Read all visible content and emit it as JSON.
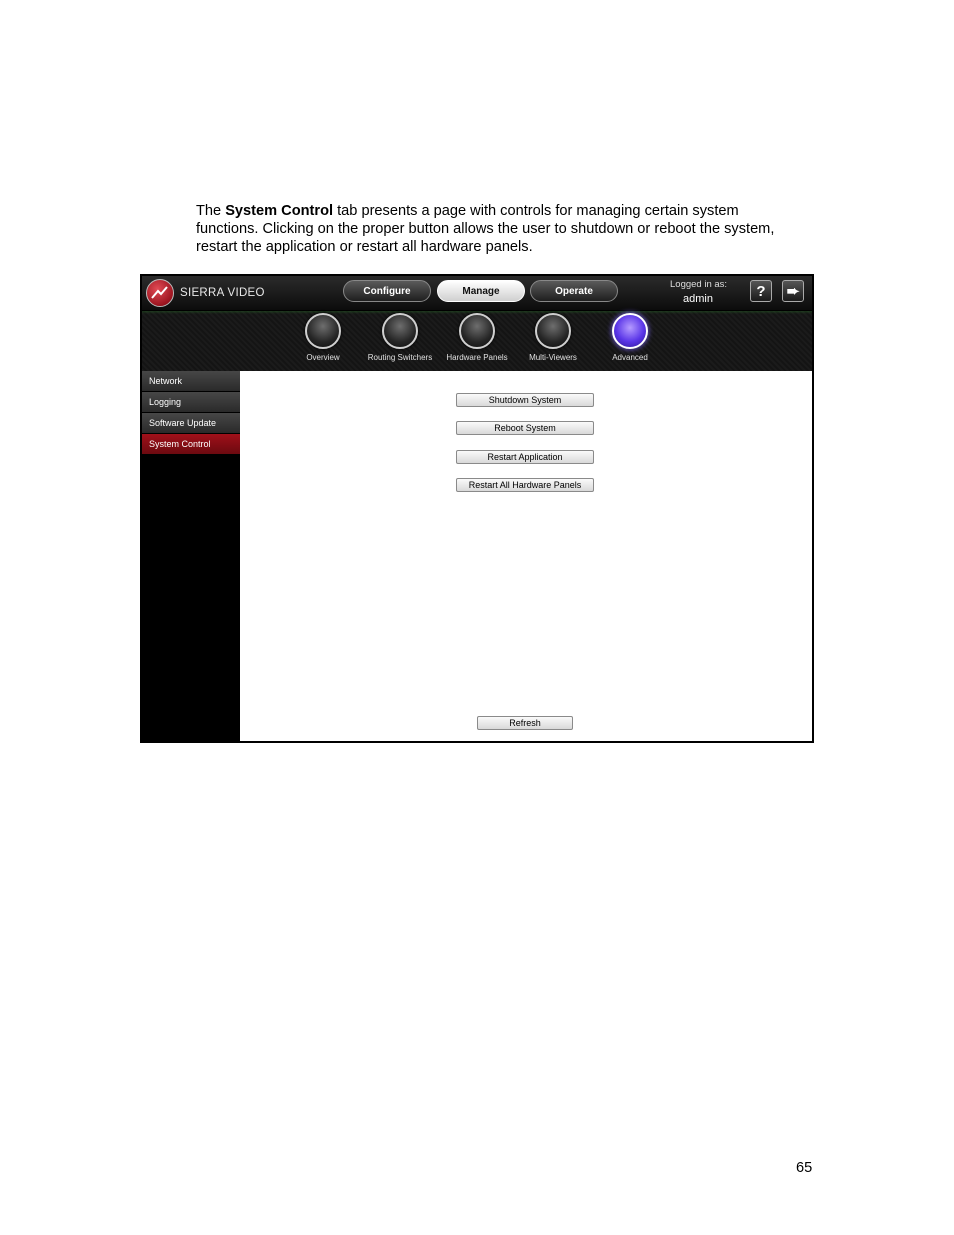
{
  "intro": {
    "before": "The ",
    "bold": "System Control",
    "after": " tab presents a page with controls for managing certain system functions. Clicking on the proper button allows the user to shutdown or reboot the system, restart the application or restart all hardware panels."
  },
  "app": {
    "brand": "SIERRA VIDEO",
    "nav": [
      "Configure",
      "Manage",
      "Operate"
    ],
    "active_nav": "Manage",
    "logged_in_label": "Logged in as:",
    "user": "admin",
    "help_glyph": "?",
    "logout_glyph": "➨",
    "icons": [
      {
        "label": "Overview",
        "icon": "overview-orb-icon"
      },
      {
        "label": "Routing Switchers",
        "icon": "routing-switchers-orb-icon"
      },
      {
        "label": "Hardware Panels",
        "icon": "hardware-panels-orb-icon"
      },
      {
        "label": "Multi-Viewers",
        "icon": "multi-viewers-orb-icon"
      },
      {
        "label": "Advanced",
        "icon": "advanced-orb-icon"
      }
    ],
    "active_icon": "Advanced",
    "sidebar": [
      "Network",
      "Logging",
      "Software Update",
      "System Control"
    ],
    "active_sidebar": "System Control",
    "buttons": {
      "shutdown": "Shutdown System",
      "reboot": "Reboot System",
      "restart_app": "Restart Application",
      "restart_panels": "Restart All Hardware Panels",
      "refresh": "Refresh"
    },
    "colors": {
      "accent_active_sidebar": "#8b0d15",
      "active_orb": "#5b36e8"
    }
  },
  "page_number": "65"
}
